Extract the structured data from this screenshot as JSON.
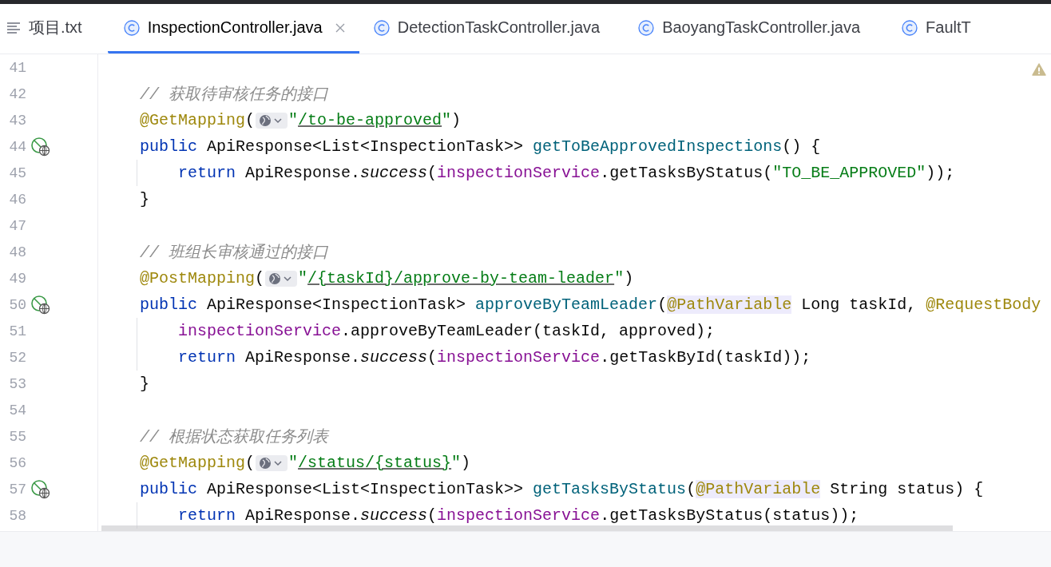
{
  "tabs": [
    {
      "label": "项目.txt",
      "kind": "text",
      "selected": false
    },
    {
      "label": "InspectionController.java",
      "kind": "class",
      "selected": true
    },
    {
      "label": "DetectionTaskController.java",
      "kind": "class",
      "selected": false
    },
    {
      "label": "BaoyangTaskController.java",
      "kind": "class",
      "selected": false
    },
    {
      "label": "FaultT",
      "kind": "class",
      "selected": false
    }
  ],
  "editor": {
    "warning": true,
    "lines": [
      {
        "number": "41",
        "endpoint_marker": false
      },
      {
        "number": "42",
        "endpoint_marker": false,
        "indent": false,
        "tokens": [
          {
            "t": "// 获取待审核任务的接口",
            "kind": "comment"
          }
        ]
      },
      {
        "number": "43",
        "endpoint_marker": false,
        "indent": false,
        "tokens": [
          {
            "t": "@GetMapping",
            "kind": "anno"
          },
          {
            "t": "(",
            "kind": "plain"
          },
          {
            "kind": "globe"
          },
          {
            "t": "\"",
            "kind": "str"
          },
          {
            "t": "/to-be-approved",
            "kind": "url"
          },
          {
            "t": "\"",
            "kind": "str"
          },
          {
            "t": ")",
            "kind": "plain"
          }
        ]
      },
      {
        "number": "44",
        "endpoint_marker": true,
        "indent": false,
        "tokens": [
          {
            "t": "public",
            "kind": "kw"
          },
          {
            "t": " ApiResponse<List<InspectionTask>> ",
            "kind": "plain"
          },
          {
            "t": "getToBeApprovedInspections",
            "kind": "fn"
          },
          {
            "t": "() {",
            "kind": "plain"
          }
        ]
      },
      {
        "number": "45",
        "endpoint_marker": false,
        "indent": true,
        "tokens": [
          {
            "t": "return",
            "kind": "kw"
          },
          {
            "t": " ApiResponse.",
            "kind": "plain"
          },
          {
            "t": "success",
            "kind": "static"
          },
          {
            "t": "(",
            "kind": "plain"
          },
          {
            "t": "inspectionService",
            "kind": "field"
          },
          {
            "t": ".getTasksByStatus(",
            "kind": "plain"
          },
          {
            "t": "\"TO_BE_APPROVED\"",
            "kind": "str"
          },
          {
            "t": "));",
            "kind": "plain"
          }
        ]
      },
      {
        "number": "46",
        "endpoint_marker": false,
        "indent": false,
        "tokens": [
          {
            "t": "}",
            "kind": "plain"
          }
        ]
      },
      {
        "number": "47",
        "endpoint_marker": false
      },
      {
        "number": "48",
        "endpoint_marker": false,
        "indent": false,
        "tokens": [
          {
            "t": "// 班组长审核通过的接口",
            "kind": "comment"
          }
        ]
      },
      {
        "number": "49",
        "endpoint_marker": false,
        "indent": false,
        "tokens": [
          {
            "t": "@PostMapping",
            "kind": "anno"
          },
          {
            "t": "(",
            "kind": "plain"
          },
          {
            "kind": "globe"
          },
          {
            "t": "\"",
            "kind": "str"
          },
          {
            "t": "/{taskId}/approve-by-team-leader",
            "kind": "url"
          },
          {
            "t": "\"",
            "kind": "str"
          },
          {
            "t": ")",
            "kind": "plain"
          }
        ]
      },
      {
        "number": "50",
        "endpoint_marker": true,
        "indent": false,
        "tokens": [
          {
            "t": "public",
            "kind": "kw"
          },
          {
            "t": " ApiResponse<InspectionTask> ",
            "kind": "plain"
          },
          {
            "t": "approveByTeamLeader",
            "kind": "fn"
          },
          {
            "t": "(",
            "kind": "plain"
          },
          {
            "t": "@PathVariable",
            "kind": "anno-hl"
          },
          {
            "t": " Long taskId, ",
            "kind": "plain"
          },
          {
            "t": "@RequestBody",
            "kind": "anno"
          }
        ]
      },
      {
        "number": "51",
        "endpoint_marker": false,
        "indent": true,
        "tokens": [
          {
            "t": "inspectionService",
            "kind": "field"
          },
          {
            "t": ".approveByTeamLeader(taskId, approved);",
            "kind": "plain"
          }
        ]
      },
      {
        "number": "52",
        "endpoint_marker": false,
        "indent": true,
        "tokens": [
          {
            "t": "return",
            "kind": "kw"
          },
          {
            "t": " ApiResponse.",
            "kind": "plain"
          },
          {
            "t": "success",
            "kind": "static"
          },
          {
            "t": "(",
            "kind": "plain"
          },
          {
            "t": "inspectionService",
            "kind": "field"
          },
          {
            "t": ".getTaskById(taskId));",
            "kind": "plain"
          }
        ]
      },
      {
        "number": "53",
        "endpoint_marker": false,
        "indent": false,
        "tokens": [
          {
            "t": "}",
            "kind": "plain"
          }
        ]
      },
      {
        "number": "54",
        "endpoint_marker": false
      },
      {
        "number": "55",
        "endpoint_marker": false,
        "indent": false,
        "tokens": [
          {
            "t": "// 根据状态获取任务列表",
            "kind": "comment"
          }
        ]
      },
      {
        "number": "56",
        "endpoint_marker": false,
        "indent": false,
        "tokens": [
          {
            "t": "@GetMapping",
            "kind": "anno"
          },
          {
            "t": "(",
            "kind": "plain"
          },
          {
            "kind": "globe"
          },
          {
            "t": "\"",
            "kind": "str"
          },
          {
            "t": "/status/{status}",
            "kind": "url"
          },
          {
            "t": "\"",
            "kind": "str"
          },
          {
            "t": ")",
            "kind": "plain"
          }
        ]
      },
      {
        "number": "57",
        "endpoint_marker": true,
        "indent": false,
        "tokens": [
          {
            "t": "public",
            "kind": "kw"
          },
          {
            "t": " ApiResponse<List<InspectionTask>> ",
            "kind": "plain"
          },
          {
            "t": "getTasksByStatus",
            "kind": "fn"
          },
          {
            "t": "(",
            "kind": "plain"
          },
          {
            "t": "@PathVariable",
            "kind": "anno-hl"
          },
          {
            "t": " String status) {",
            "kind": "plain"
          }
        ]
      },
      {
        "number": "58",
        "endpoint_marker": false,
        "indent": true,
        "tokens": [
          {
            "t": "return",
            "kind": "kw"
          },
          {
            "t": " ApiResponse.",
            "kind": "plain"
          },
          {
            "t": "success",
            "kind": "static"
          },
          {
            "t": "(",
            "kind": "plain"
          },
          {
            "t": "inspectionService",
            "kind": "field"
          },
          {
            "t": ".getTasksByStatus(status));",
            "kind": "plain"
          }
        ]
      }
    ]
  }
}
